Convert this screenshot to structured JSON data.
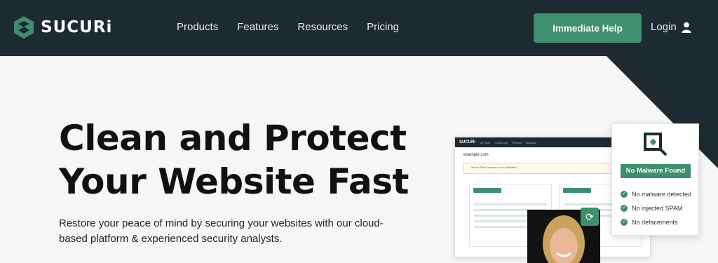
{
  "brand": {
    "name": "SUCURi"
  },
  "nav": {
    "items": [
      "Products",
      "Features",
      "Resources",
      "Pricing"
    ],
    "cta_label": "Immediate Help",
    "login_label": "Login"
  },
  "hero": {
    "headline_line1": "Clean and Protect",
    "headline_line2": "Your Website Fast",
    "subtext": "Restore your peace of mind by securing your websites with our cloud-based platform & experienced security analysts."
  },
  "status_card": {
    "badge": "No Malware Found",
    "checks": [
      "No malware detected",
      "No injected SPAM",
      "No defacements"
    ]
  },
  "dashboard": {
    "logo": "SUCURi",
    "tabs": [
      "My Sites",
      "Monitoring",
      "Firewall",
      "Backups"
    ],
    "site": "example.com",
    "alert": "Server Side Scanner is not activated"
  },
  "colors": {
    "nav_bg": "#1e2a31",
    "accent": "#3d8f6e",
    "hero_bg": "#f6f6f6"
  },
  "icons": [
    "sucuri-logo-icon",
    "user-icon",
    "magnifier-icon",
    "sync-icon",
    "checkmark-icon"
  ]
}
